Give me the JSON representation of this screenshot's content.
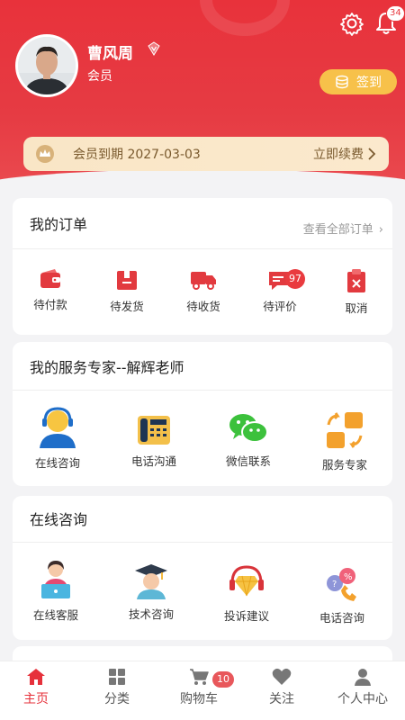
{
  "header": {
    "notification_count": "34",
    "user": {
      "name": "曹风周",
      "level": "会员"
    },
    "signin_label": "签到",
    "membership": {
      "expiry_text": "会员到期 2027-03-03",
      "renew_label": "立即续费"
    }
  },
  "orders": {
    "title": "我的订单",
    "view_all": "查看全部订单",
    "items": [
      {
        "label": "待付款",
        "icon": "wallet-icon"
      },
      {
        "label": "待发货",
        "icon": "package-icon"
      },
      {
        "label": "待收货",
        "icon": "truck-icon"
      },
      {
        "label": "待评价",
        "icon": "review-icon",
        "badge": "97"
      },
      {
        "label": "取消",
        "icon": "cancel-clipboard-icon"
      }
    ]
  },
  "service_expert": {
    "title": "我的服务专家--解辉老师",
    "items": [
      {
        "label": "在线咨询",
        "icon": "headset-agent-icon"
      },
      {
        "label": "电话沟通",
        "icon": "desk-phone-icon"
      },
      {
        "label": "微信联系",
        "icon": "wechat-icon"
      },
      {
        "label": "服务专家",
        "icon": "exchange-icon"
      }
    ]
  },
  "online_consult": {
    "title": "在线咨询",
    "items": [
      {
        "label": "在线客服",
        "icon": "customer-service-icon"
      },
      {
        "label": "技术咨询",
        "icon": "graduate-icon"
      },
      {
        "label": "投诉建议",
        "icon": "diamond-headset-icon"
      },
      {
        "label": "电话咨询",
        "icon": "phone-percent-icon"
      }
    ]
  },
  "tabbar": {
    "items": [
      {
        "label": "主页",
        "icon": "home-icon",
        "active": true
      },
      {
        "label": "分类",
        "icon": "grid-icon"
      },
      {
        "label": "购物车",
        "icon": "cart-icon",
        "badge": "10"
      },
      {
        "label": "关注",
        "icon": "heart-icon"
      },
      {
        "label": "个人中心",
        "icon": "person-icon"
      }
    ]
  },
  "colors": {
    "primary": "#e6313b",
    "gold": "#f7c14a",
    "member_bg": "#f9e6c6"
  }
}
